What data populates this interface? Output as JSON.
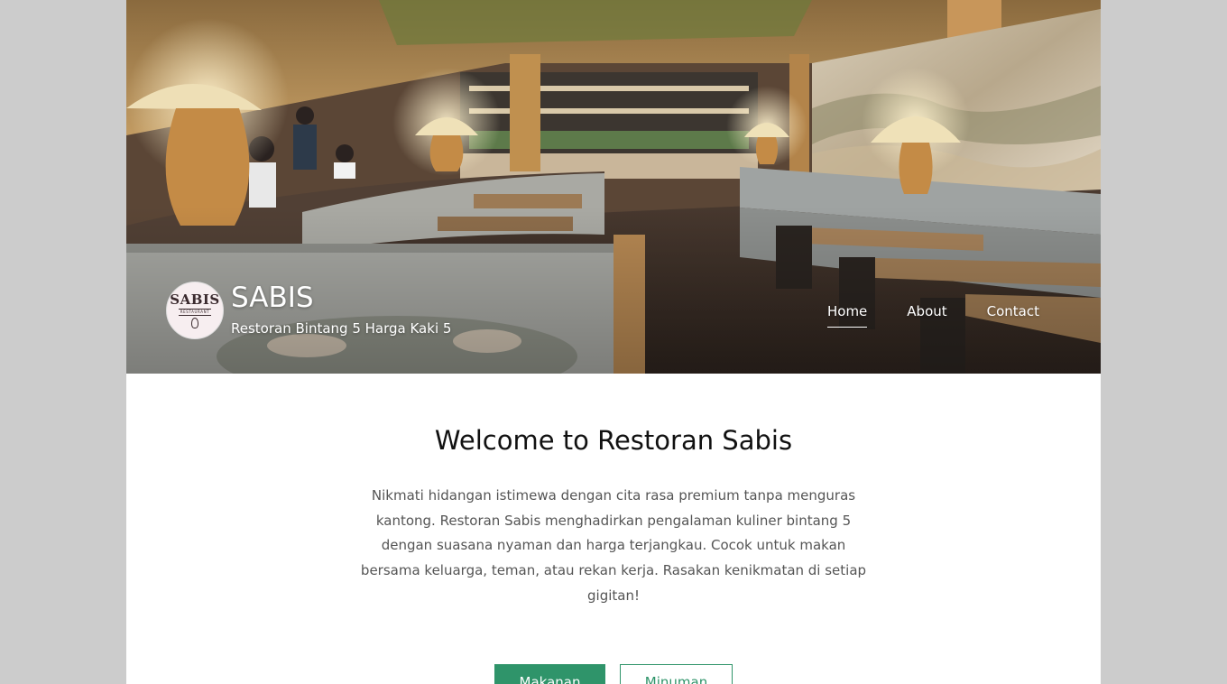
{
  "header": {
    "site_title": "SABIS",
    "tagline": "Restoran Bintang 5 Harga Kaki 5",
    "logo": {
      "word": "SABIS",
      "sub": "RESTAURANT"
    },
    "nav": [
      {
        "label": "Home",
        "active": true
      },
      {
        "label": "About",
        "active": false
      },
      {
        "label": "Contact",
        "active": false
      }
    ]
  },
  "main": {
    "heading": "Welcome to Restoran Sabis",
    "description": "Nikmati hidangan istimewa dengan cita rasa premium tanpa menguras kantong. Restoran Sabis menghadirkan pengalaman kuliner bintang 5 dengan suasana nyaman dan harga terjangkau. Cocok untuk makan bersama keluarga, teman, atau rekan kerja. Rasakan kenikmatan di setiap gigitan!",
    "buttons": {
      "food": "Makanan",
      "drinks": "Minuman"
    }
  },
  "colors": {
    "accent": "#2f946a",
    "page_background": "#cccccc"
  }
}
